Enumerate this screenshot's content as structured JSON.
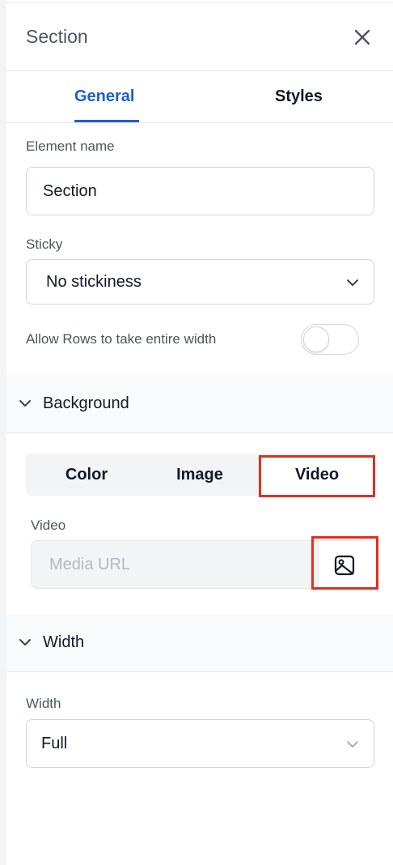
{
  "panel": {
    "title": "Section",
    "close_icon": "close-icon"
  },
  "tabs": [
    {
      "label": "General",
      "active": true
    },
    {
      "label": "Styles",
      "active": false
    }
  ],
  "general": {
    "element_name": {
      "label": "Element name",
      "value": "Section"
    },
    "sticky": {
      "label": "Sticky",
      "value": "No stickiness"
    },
    "allow_rows": {
      "label": "Allow Rows to take entire width",
      "on": false
    }
  },
  "background": {
    "title": "Background",
    "expanded": true,
    "tabs": [
      "Color",
      "Image",
      "Video"
    ],
    "selected_tab": "Video",
    "video": {
      "label": "Video",
      "placeholder": "Media URL",
      "media_icon": "image-icon"
    }
  },
  "width_section": {
    "title": "Width",
    "expanded": true,
    "field": {
      "label": "Width",
      "value": "Full"
    }
  },
  "colors": {
    "accent": "#1e5ecf",
    "highlight": "#e0301e"
  }
}
